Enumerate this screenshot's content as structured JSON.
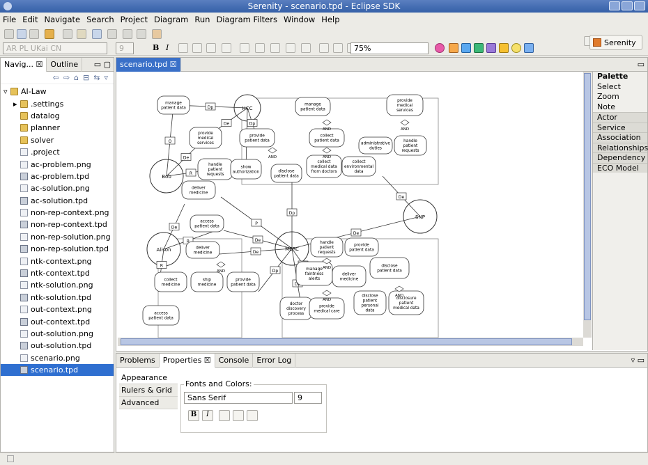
{
  "window": {
    "title": "Serenity - scenario.tpd - Eclipse SDK"
  },
  "menu": [
    "File",
    "Edit",
    "Navigate",
    "Search",
    "Project",
    "Diagram",
    "Run",
    "Diagram Filters",
    "Window",
    "Help"
  ],
  "toolbar": {
    "font_name": "AR PL UKai CN",
    "font_size": "9",
    "zoom": "75%",
    "perspective": "Serenity",
    "bold": "B",
    "italic": "I"
  },
  "left_view": {
    "tabs": [
      "Navig...",
      "Outline"
    ],
    "root": "AI-Law",
    "items": [
      {
        "label": ".settings",
        "kind": "folder"
      },
      {
        "label": "datalog",
        "kind": "folder"
      },
      {
        "label": "planner",
        "kind": "folder"
      },
      {
        "label": "solver",
        "kind": "folder"
      },
      {
        "label": ".project",
        "kind": "file"
      },
      {
        "label": "ac-problem.png",
        "kind": "file"
      },
      {
        "label": "ac-problem.tpd",
        "kind": "tpd"
      },
      {
        "label": "ac-solution.png",
        "kind": "file"
      },
      {
        "label": "ac-solution.tpd",
        "kind": "tpd"
      },
      {
        "label": "non-rep-context.png",
        "kind": "file"
      },
      {
        "label": "non-rep-context.tpd",
        "kind": "tpd"
      },
      {
        "label": "non-rep-solution.png",
        "kind": "file"
      },
      {
        "label": "non-rep-solution.tpd",
        "kind": "tpd"
      },
      {
        "label": "ntk-context.png",
        "kind": "file"
      },
      {
        "label": "ntk-context.tpd",
        "kind": "tpd"
      },
      {
        "label": "ntk-solution.png",
        "kind": "file"
      },
      {
        "label": "ntk-solution.tpd",
        "kind": "tpd"
      },
      {
        "label": "out-context.png",
        "kind": "file"
      },
      {
        "label": "out-context.tpd",
        "kind": "tpd"
      },
      {
        "label": "out-solution.png",
        "kind": "file"
      },
      {
        "label": "out-solution.tpd",
        "kind": "tpd"
      },
      {
        "label": "scenario.png",
        "kind": "file"
      },
      {
        "label": "scenario.tpd",
        "kind": "tpd",
        "selected": true
      }
    ]
  },
  "editor": {
    "tab": "scenario.tpd"
  },
  "palette": {
    "title": "Palette",
    "tools": [
      "Select",
      "Zoom",
      "Note"
    ],
    "groups": [
      "Actor",
      "Service",
      "Association",
      "Relationships",
      "Dependency",
      "ECO Model"
    ]
  },
  "diagram": {
    "actors": [
      "HCC",
      "Bob",
      "SNP",
      "Alison",
      "MERC"
    ],
    "services": [
      "manage patient data",
      "provide medical services",
      "handle patient requests",
      "manage patient data",
      "provide medical services",
      "provide patient data",
      "collect patient data",
      "administrative duties",
      "handle patient requests",
      "show authorization",
      "disclose patient data",
      "collect medical data from doctors",
      "collect environmental data",
      "deliver medicine",
      "access patient data",
      "deliver medicine",
      "collect medicine",
      "ship medicine",
      "access patient data",
      "provide patient data",
      "handle patient requests",
      "provide patient data",
      "manage faintness alerts",
      "deliver medicine",
      "disclose patient data",
      "doctor discovery process",
      "provide medical care",
      "disclose patient personal data",
      "disclosure patient medical data"
    ],
    "links": [
      "Dp",
      "De",
      "Dp",
      "De",
      "R",
      "O",
      "P",
      "P",
      "De",
      "De",
      "Dp",
      "De",
      "R",
      "Dp",
      "Dp",
      "P",
      "De",
      "De",
      "R"
    ],
    "and_label": "AND"
  },
  "bottom": {
    "tabs": [
      "Problems",
      "Properties",
      "Console",
      "Error Log"
    ],
    "prop_tabs": [
      "Appearance",
      "Rulers & Grid",
      "Advanced"
    ],
    "fonts_colors": "Fonts and Colors:",
    "font": "Sans Serif",
    "size": "9"
  },
  "colors": {
    "selection": "#2f6fd0",
    "title": "#3560a8"
  }
}
